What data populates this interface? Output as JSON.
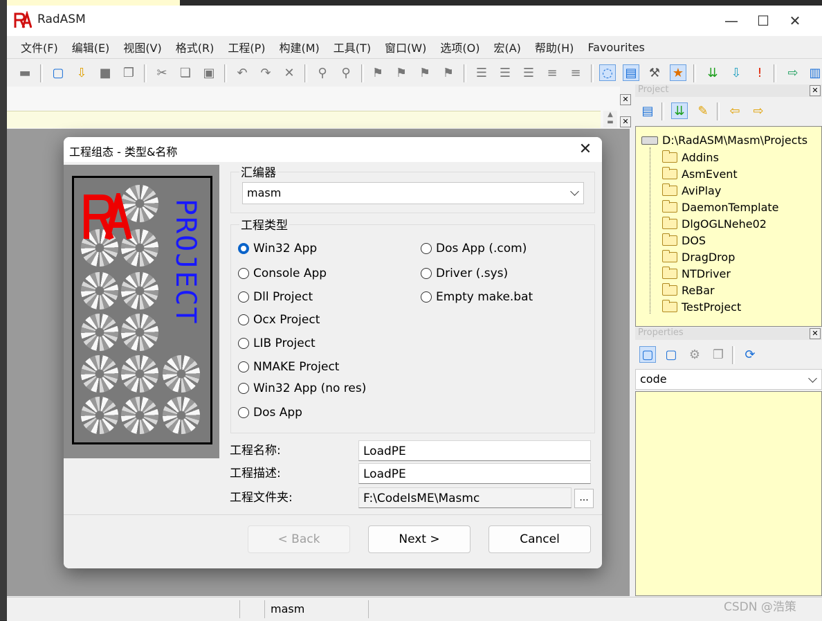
{
  "window": {
    "title": "RadASM",
    "logo_text": "RA",
    "controls": [
      "—",
      "☐",
      "✕"
    ]
  },
  "menu": [
    "文件(F)",
    "编辑(E)",
    "视图(V)",
    "格式(R)",
    "工程(P)",
    "构建(M)",
    "工具(T)",
    "窗口(W)",
    "选项(O)",
    "宏(A)",
    "帮助(H)",
    "Favourites"
  ],
  "project_pane": {
    "title": "Project",
    "root": "D:\\RadASM\\Masm\\Projects",
    "folders": [
      "Addins",
      "AsmEvent",
      "AviPlay",
      "DaemonTemplate",
      "DlgOGLNehe02",
      "DOS",
      "DragDrop",
      "NTDriver",
      "ReBar",
      "TestProject"
    ]
  },
  "properties_pane": {
    "title": "Properties",
    "selected": "code"
  },
  "status": {
    "assembler": "masm",
    "watermark": "CSDN @浩策"
  },
  "dialog": {
    "title": "工程组态 - 类型&名称",
    "close": "✕",
    "logo_vertical_text": "PROJECT",
    "assembler_label": "汇编器",
    "assembler_value": "masm",
    "project_type_label": "工程类型",
    "types_left": [
      "Win32 App",
      "Console App",
      "Dll Project",
      "Ocx Project",
      "LIB Project",
      "NMAKE Project",
      "Win32 App (no res)",
      "Dos App"
    ],
    "types_right": [
      "Dos App (.com)",
      "Driver (.sys)",
      "Empty make.bat"
    ],
    "selected_type": "Win32 App",
    "name_label": "工程名称:",
    "name_value": "LoadPE",
    "desc_label": "工程描述:",
    "desc_value": "LoadPE",
    "folder_label": "工程文件夹:",
    "folder_value": "F:\\CodeIsME\\Masmc",
    "browse": "...",
    "back": "< Back",
    "next": "Next >",
    "cancel": "Cancel"
  }
}
